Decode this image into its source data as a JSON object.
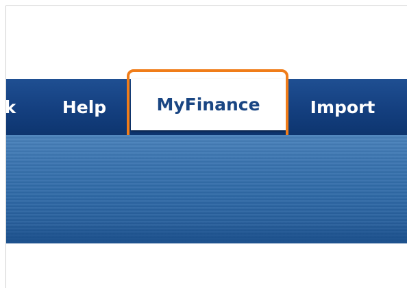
{
  "nav": {
    "partial_label": "k",
    "help_label": "Help",
    "myfinance_label": "MyFinance",
    "import_label": "Import"
  },
  "colors": {
    "nav_bar": "#143f7f",
    "active_tab_text": "#1a4683",
    "highlight_border": "#f07d1a",
    "banner": "#2f6aa7"
  }
}
